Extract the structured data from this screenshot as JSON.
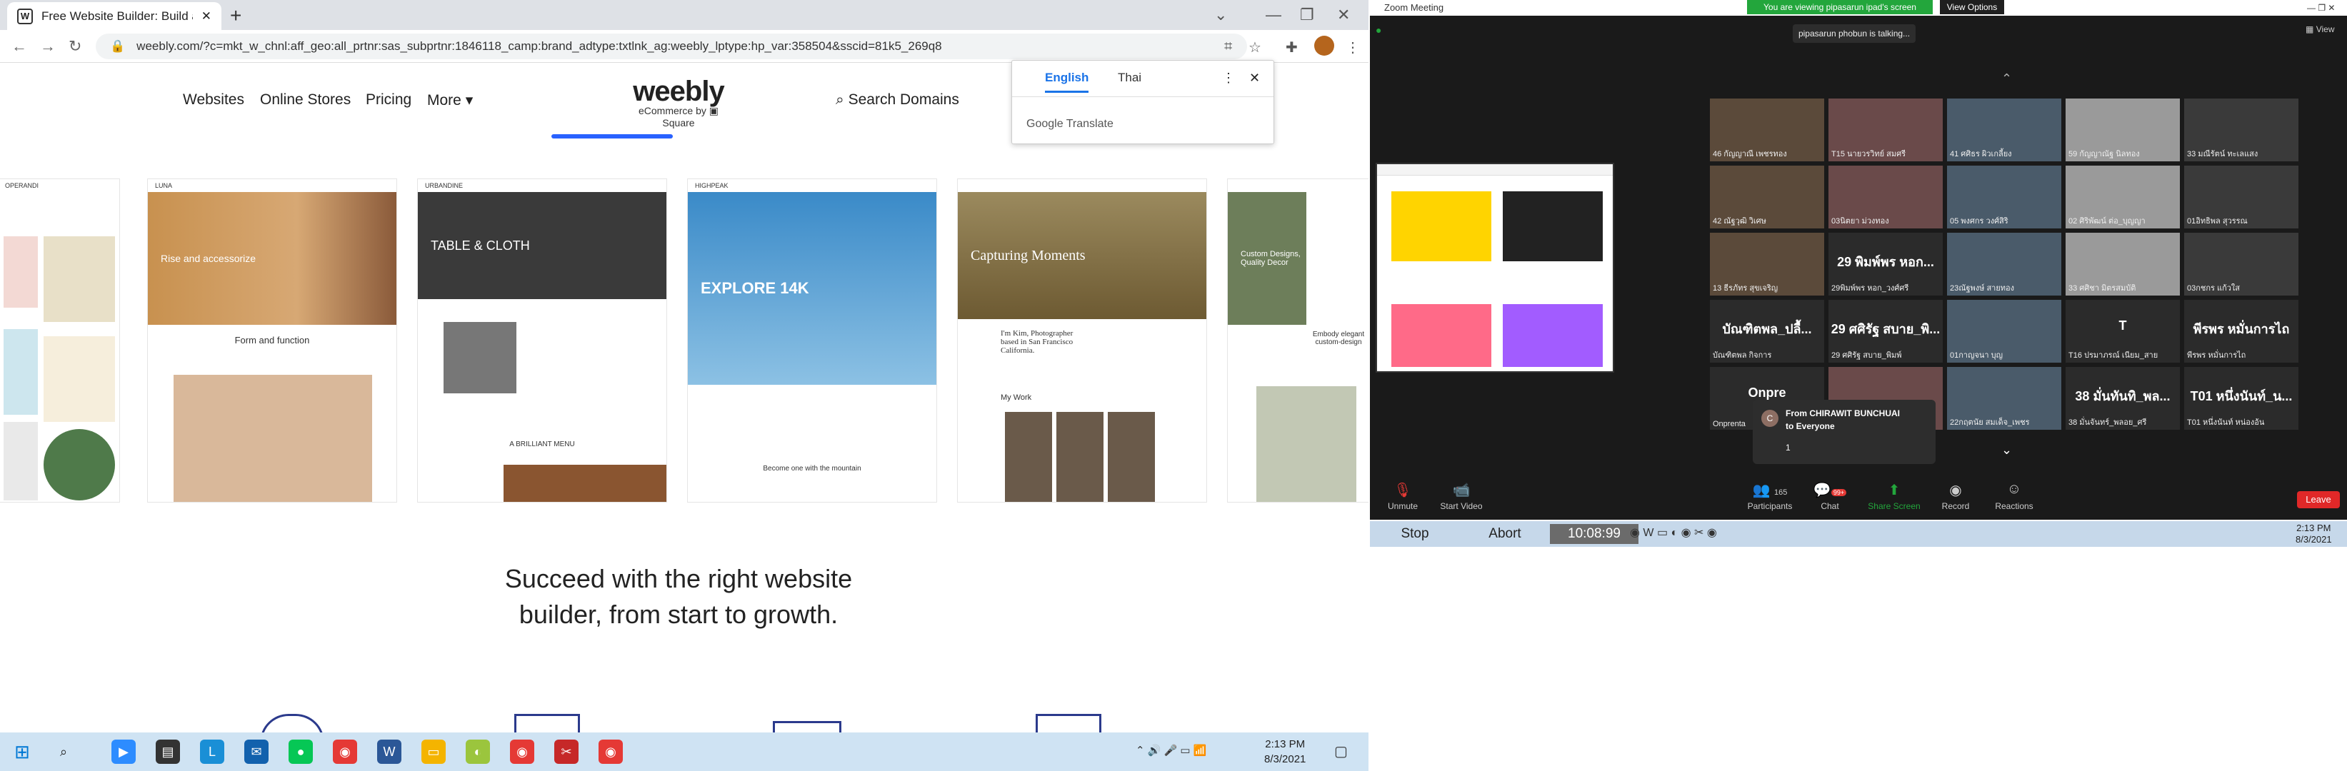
{
  "browser": {
    "tab_title": "Free Website Builder: Build a Fre",
    "url": "weebly.com/?c=mkt_w_chnl:aff_geo:all_prtnr:sas_subprtnr:1846118_camp:brand_adtype:txtlnk_ag:weebly_lptype:hp_var:358504&sscid=81k5_269q8",
    "new_tab": "+"
  },
  "nav": {
    "websites": "Websites",
    "stores": "Online Stores",
    "pricing": "Pricing",
    "more": "More",
    "logo": "weebly",
    "logo_sub": "eCommerce by",
    "logo_square": "Square",
    "search": "Search Domains"
  },
  "translate": {
    "english": "English",
    "thai": "Thai",
    "brand": "Google Translate"
  },
  "templates": [
    {
      "label": "OPERANDI"
    },
    {
      "label": "LUNA",
      "hero": "Rise and accessorize",
      "caption": "Form and function"
    },
    {
      "label": "URBANDINE",
      "hero": "TABLE & CLOTH",
      "caption": "A BRILLIANT MENU"
    },
    {
      "label": "HIGHPEAK",
      "hero": "EXPLORE 14K",
      "caption": "Become one with the mountain"
    },
    {
      "label": "",
      "hero": "Capturing Moments",
      "caption": "I'm Kim, Photographer based in San Francisco California.",
      "caption2": "My Work"
    },
    {
      "label": "",
      "hero": "Custom Designs, Quality Decor",
      "caption": "Embody elegant custom-design"
    }
  ],
  "headline": {
    "line1": "Succeed with the right website",
    "line2": "builder, from start to growth."
  },
  "taskbar_left": {
    "time": "2:13 PM",
    "date": "8/3/2021"
  },
  "zoom": {
    "title": "Zoom Meeting",
    "viewing": "You are viewing pipasarun ipad's screen",
    "view_options": "View Options",
    "talking": "pipasarun phobun is talking...",
    "gallery": "View",
    "tiles": [
      {
        "name": "46 กัญญาณี เพชรทอง"
      },
      {
        "name": "T15 นายวรวิทย์ สมศรี"
      },
      {
        "name": "41 ศศิธร ผิวเกลี้ยง"
      },
      {
        "name": "59 กัญญาณัฐ นิลทอง"
      },
      {
        "name": "33 มณีรัตน์ ทะเลแสง"
      },
      {
        "name": "42 ณัฐวุฒิ วิเศษ"
      },
      {
        "name": "03นิตยา ม่วงทอง"
      },
      {
        "name": "05 พงศกร วงศ์สิริ"
      },
      {
        "name": "02 ศิริพัฒน์ ต่อ_บุญญา"
      },
      {
        "name": "01อิทธิพล สุวรรณ"
      },
      {
        "name": "13 ธีรภัทร สุขเจริญ"
      },
      {
        "name": "29พิมพ์พร หอก_วงศ์ศรี",
        "big": "29 พิมพ์พร หอก..."
      },
      {
        "name": "23ณัฐพงษ์ สายทอง"
      },
      {
        "name": "33 ศศิชา มิตรสมบัติ"
      },
      {
        "name": "03กชกร แก้วใส"
      },
      {
        "name": "บัณฑิตพล กิจการ",
        "big": "บัณฑิตพล_ปลื้..."
      },
      {
        "name": "29 ศศิรัฐ สบาย_พิมพ์",
        "big": "29 ศศิรัฐ สบาย_พิ..."
      },
      {
        "name": "01กาญจนา บุญ"
      },
      {
        "name": "T16 ปรมาภรณ์ เนียม_สาย",
        "big": "T"
      },
      {
        "name": "พีรพร หมั่นการไถ",
        "big": "พีรพร หมั่นการไถ"
      },
      {
        "name": "Onprenta",
        "big": "Onpre"
      },
      {
        "name": "C"
      },
      {
        "name": "22กฤตนัย สมเด็จ_เพชร"
      },
      {
        "name": "38 มั่นจันทร์_พลอย_ศรี",
        "big": "38 มั่นทันทิ_พล..."
      },
      {
        "name": "T01 หนึ่งนันท์ หน่องอ้น",
        "big": "T01 หนึ่งนันท์_น..."
      }
    ],
    "chat_from": "From CHIRAWIT BUNCHUAI",
    "chat_to": "to Everyone",
    "chat_msg": "1",
    "controls": {
      "unmute": "Unmute",
      "video": "Start Video",
      "participants": "Participants",
      "participants_count": "165",
      "chat": "Chat",
      "chat_badge": "99+",
      "share": "Share Screen",
      "record": "Record",
      "reactions": "Reactions",
      "leave": "Leave"
    }
  },
  "recorder": {
    "stop": "Stop",
    "abort": "Abort",
    "time": "10:08:99"
  },
  "taskbar_right": {
    "time": "2:13 PM",
    "date": "8/3/2021"
  }
}
